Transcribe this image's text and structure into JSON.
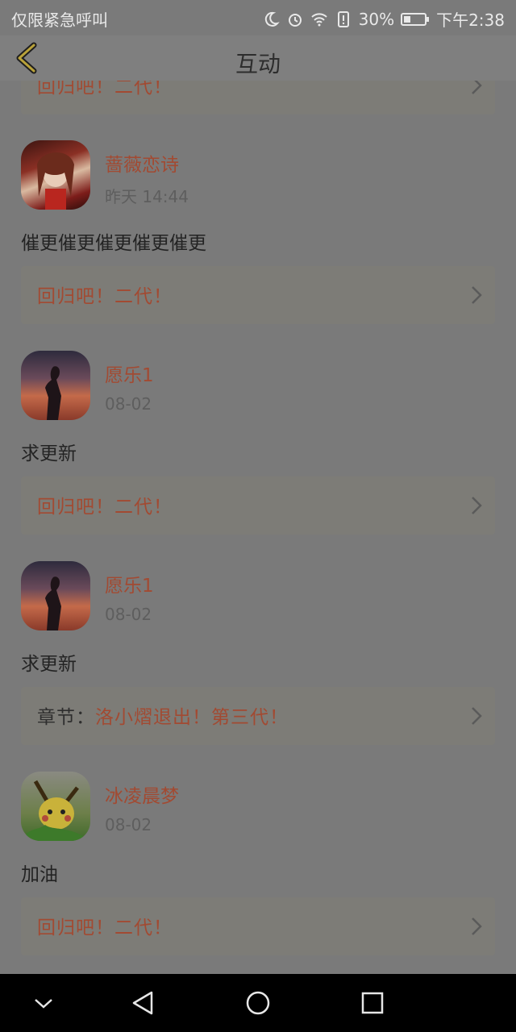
{
  "status_bar": {
    "carrier": "仅限紧急呼叫",
    "battery": "30%",
    "time": "下午2:38",
    "icons": [
      "moon-icon",
      "alarm-icon",
      "wifi-icon",
      "sim-alert-icon",
      "battery-icon"
    ]
  },
  "header": {
    "title": "互动",
    "back_icon": "chevron-left-icon"
  },
  "partial_top_card": {
    "text": "回归吧！二代！"
  },
  "items": [
    {
      "user": "蔷薇恋诗",
      "time": "昨天 14:44",
      "comment": "催更催更催更催更催更",
      "chapter_prefix": "",
      "chapter": "回归吧！二代！",
      "avatar": "anime-girl-avatar"
    },
    {
      "user": "愿乐1",
      "time": "08-02",
      "comment": "求更新",
      "chapter_prefix": "",
      "chapter": "回归吧！二代！",
      "avatar": "sunset-silhouette-avatar"
    },
    {
      "user": "愿乐1",
      "time": "08-02",
      "comment": "求更新",
      "chapter_prefix": "章节：",
      "chapter": "洛小熠退出！第三代！",
      "avatar": "sunset-silhouette-avatar"
    },
    {
      "user": "冰凌晨梦",
      "time": "08-02",
      "comment": "加油",
      "chapter_prefix": "",
      "chapter": "回归吧！二代！",
      "avatar": "pikachu-avatar"
    }
  ],
  "nav_bar": {
    "icons": [
      "chevron-down-icon",
      "back-triangle-icon",
      "home-circle-icon",
      "recents-square-icon"
    ]
  }
}
